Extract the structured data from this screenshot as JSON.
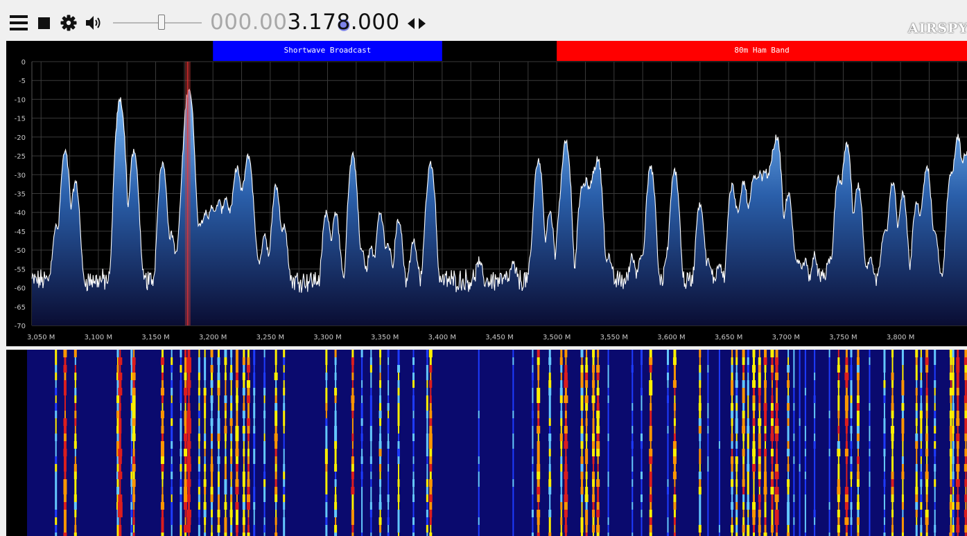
{
  "toolbar": {
    "menu_icon": "hamburger-menu-icon",
    "stop_icon": "stop-icon",
    "settings_icon": "gear-icon",
    "volume_icon": "speaker-icon",
    "volume_level": 0.55,
    "tune_icon": "left-right-arrows-icon"
  },
  "frequency": {
    "prefix_dim": "000.00",
    "before_highlight": "3.17",
    "highlighted_digit": "8",
    "after_highlight": ".000"
  },
  "logo": {
    "text": "AIRSPY"
  },
  "bands": [
    {
      "name": "Shortwave Broadcast",
      "start_mhz": 3.2,
      "end_mhz": 3.4,
      "color": "#0000ff"
    },
    {
      "name": "80m Ham Band",
      "start_mhz": 3.5,
      "end_mhz": 3.95,
      "color": "#ff0000"
    }
  ],
  "chart_data": {
    "type": "line",
    "xlim": [
      3.042,
      3.858
    ],
    "ylim": [
      -70,
      0
    ],
    "y_ticks": [
      "0",
      "-5",
      "-10",
      "-15",
      "-20",
      "-25",
      "-30",
      "-35",
      "-40",
      "-45",
      "-50",
      "-55",
      "-60",
      "-65",
      "-70"
    ],
    "x_ticks": [
      "3,050 M",
      "3,100 M",
      "3,150 M",
      "3,200 M",
      "3,250 M",
      "3,300 M",
      "3,350 M",
      "3,400 M",
      "3,450 M",
      "3,500 M",
      "3,550 M",
      "3,600 M",
      "3,650 M",
      "3,700 M",
      "3,750 M",
      "3,800 M"
    ],
    "x_tick_values": [
      3.05,
      3.1,
      3.15,
      3.2,
      3.25,
      3.3,
      3.35,
      3.4,
      3.45,
      3.5,
      3.55,
      3.6,
      3.65,
      3.7,
      3.75,
      3.8
    ],
    "tuned_frequency_mhz": 3.178,
    "noise_floor_db": -58,
    "grid": true,
    "peaks": [
      {
        "f": 3.063,
        "db": -44
      },
      {
        "f": 3.071,
        "db": -24
      },
      {
        "f": 3.08,
        "db": -32
      },
      {
        "f": 3.117,
        "db": -38
      },
      {
        "f": 3.119,
        "db": -10
      },
      {
        "f": 3.129,
        "db": -48
      },
      {
        "f": 3.131,
        "db": -24
      },
      {
        "f": 3.156,
        "db": -27
      },
      {
        "f": 3.164,
        "db": -46
      },
      {
        "f": 3.172,
        "db": -44
      },
      {
        "f": 3.176,
        "db": -26
      },
      {
        "f": 3.179,
        "db": -7
      },
      {
        "f": 3.188,
        "db": -43
      },
      {
        "f": 3.193,
        "db": -40
      },
      {
        "f": 3.199,
        "db": -38
      },
      {
        "f": 3.205,
        "db": -37
      },
      {
        "f": 3.211,
        "db": -36
      },
      {
        "f": 3.216,
        "db": -40
      },
      {
        "f": 3.221,
        "db": -28
      },
      {
        "f": 3.227,
        "db": -34
      },
      {
        "f": 3.231,
        "db": -25
      },
      {
        "f": 3.236,
        "db": -47
      },
      {
        "f": 3.245,
        "db": -46
      },
      {
        "f": 3.255,
        "db": -33
      },
      {
        "f": 3.262,
        "db": -44
      },
      {
        "f": 3.299,
        "db": -40
      },
      {
        "f": 3.307,
        "db": -40
      },
      {
        "f": 3.322,
        "db": -25
      },
      {
        "f": 3.33,
        "db": -51
      },
      {
        "f": 3.338,
        "db": -50
      },
      {
        "f": 3.346,
        "db": -40
      },
      {
        "f": 3.353,
        "db": -49
      },
      {
        "f": 3.362,
        "db": -42
      },
      {
        "f": 3.375,
        "db": -48
      },
      {
        "f": 3.387,
        "db": -44
      },
      {
        "f": 3.39,
        "db": -27
      },
      {
        "f": 3.432,
        "db": -55
      },
      {
        "f": 3.462,
        "db": -56
      },
      {
        "f": 3.479,
        "db": -52
      },
      {
        "f": 3.484,
        "db": -26
      },
      {
        "f": 3.494,
        "db": -40
      },
      {
        "f": 3.504,
        "db": -37
      },
      {
        "f": 3.508,
        "db": -21
      },
      {
        "f": 3.522,
        "db": -34
      },
      {
        "f": 3.526,
        "db": -32
      },
      {
        "f": 3.532,
        "db": -30
      },
      {
        "f": 3.536,
        "db": -26
      },
      {
        "f": 3.545,
        "db": -53
      },
      {
        "f": 3.566,
        "db": -53
      },
      {
        "f": 3.574,
        "db": -52
      },
      {
        "f": 3.582,
        "db": -28
      },
      {
        "f": 3.597,
        "db": -52
      },
      {
        "f": 3.603,
        "db": -29
      },
      {
        "f": 3.625,
        "db": -38
      },
      {
        "f": 3.632,
        "db": -55
      },
      {
        "f": 3.642,
        "db": -55
      },
      {
        "f": 3.653,
        "db": -33
      },
      {
        "f": 3.657,
        "db": -41
      },
      {
        "f": 3.663,
        "db": -32
      },
      {
        "f": 3.667,
        "db": -41
      },
      {
        "f": 3.672,
        "db": -31
      },
      {
        "f": 3.677,
        "db": -30
      },
      {
        "f": 3.682,
        "db": -29
      },
      {
        "f": 3.688,
        "db": -26
      },
      {
        "f": 3.692,
        "db": -20
      },
      {
        "f": 3.702,
        "db": -35
      },
      {
        "f": 3.707,
        "db": -53
      },
      {
        "f": 3.712,
        "db": -55
      },
      {
        "f": 3.717,
        "db": -55
      },
      {
        "f": 3.725,
        "db": -53
      },
      {
        "f": 3.738,
        "db": -54
      },
      {
        "f": 3.746,
        "db": -31
      },
      {
        "f": 3.753,
        "db": -22
      },
      {
        "f": 3.757,
        "db": -48
      },
      {
        "f": 3.763,
        "db": -33
      },
      {
        "f": 3.773,
        "db": -54
      },
      {
        "f": 3.786,
        "db": -45
      },
      {
        "f": 3.793,
        "db": -32
      },
      {
        "f": 3.802,
        "db": -35
      },
      {
        "f": 3.814,
        "db": -38
      },
      {
        "f": 3.818,
        "db": -43
      },
      {
        "f": 3.823,
        "db": -28
      },
      {
        "f": 3.83,
        "db": -46
      },
      {
        "f": 3.844,
        "db": -30
      },
      {
        "f": 3.846,
        "db": -44
      },
      {
        "f": 3.85,
        "db": -20
      },
      {
        "f": 3.857,
        "db": -24
      }
    ]
  },
  "waterfall": {
    "colors": [
      "#0a0a6e",
      "#1e3cff",
      "#64c8ff",
      "#fff000",
      "#ff9600",
      "#dc1e1e"
    ]
  }
}
